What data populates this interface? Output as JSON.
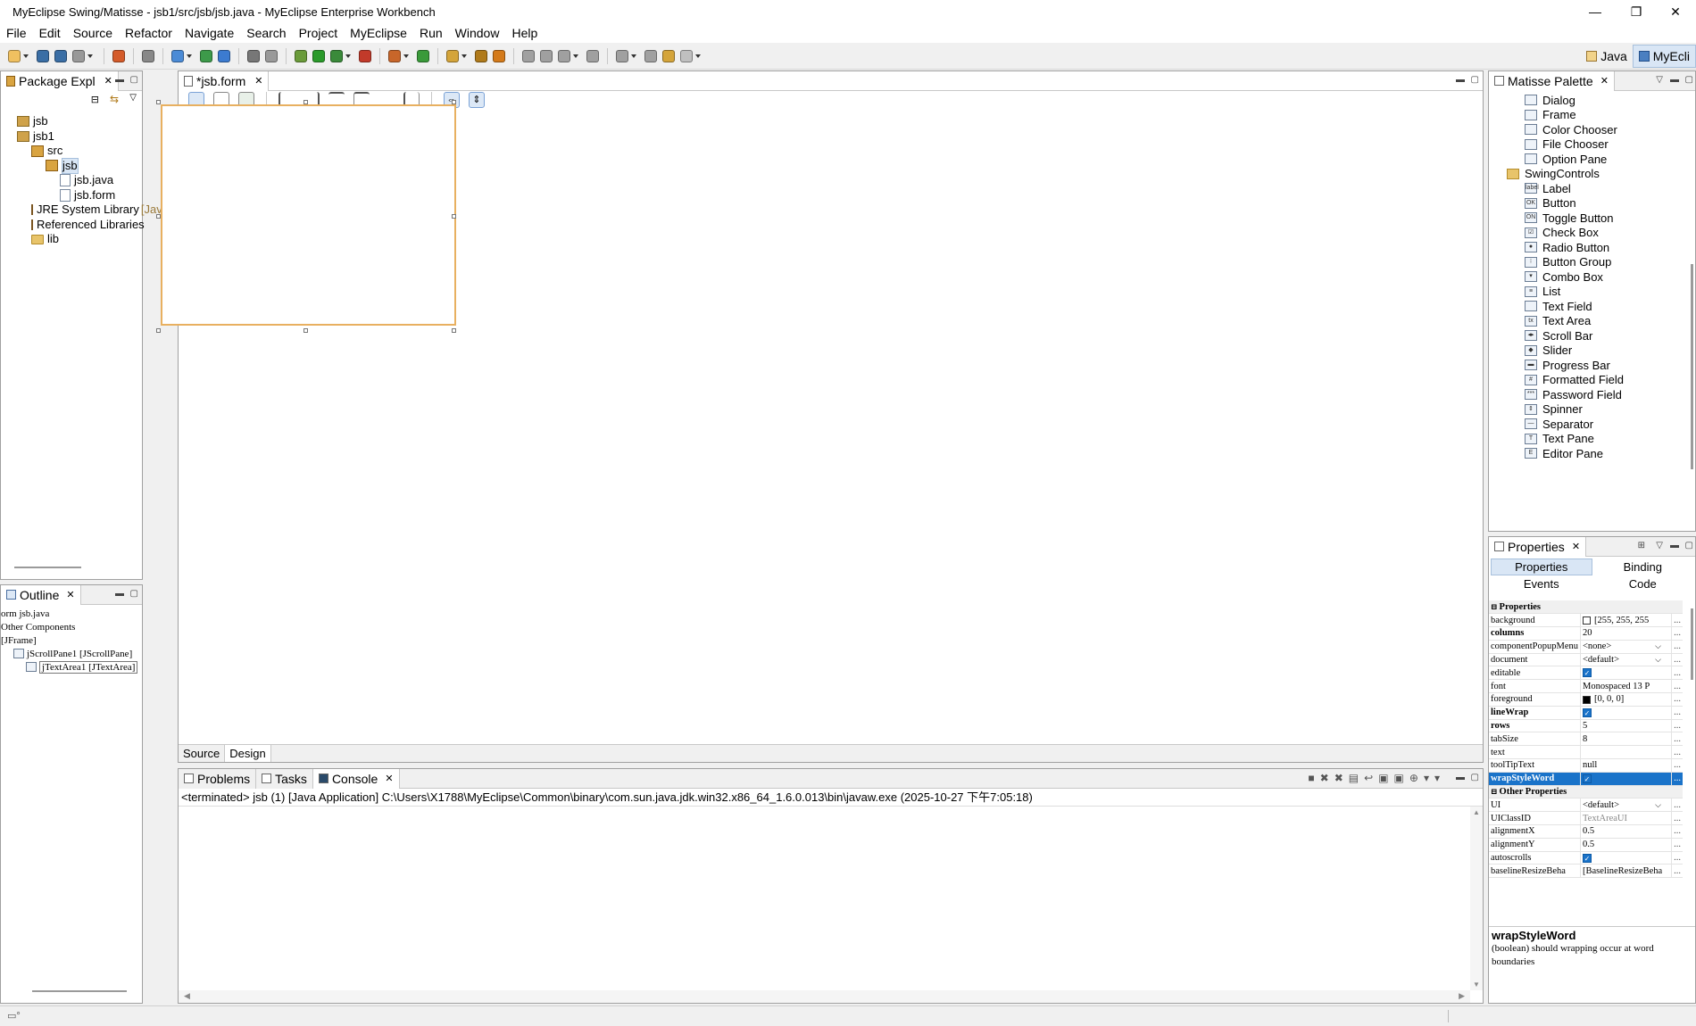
{
  "window": {
    "title": "MyEclipse Swing/Matisse - jsb1/src/jsb/jsb.java - MyEclipse Enterprise Workbench",
    "minimize": "—",
    "maximize": "❐",
    "close": "✕"
  },
  "menu": [
    "File",
    "Edit",
    "Source",
    "Refactor",
    "Navigate",
    "Search",
    "Project",
    "MyEclipse",
    "Run",
    "Window",
    "Help"
  ],
  "perspectives": {
    "java": "Java",
    "myeclipse": "MyEcli"
  },
  "package_explorer": {
    "title": "Package Expl",
    "items": [
      {
        "label": "jsb",
        "icon": "project-icon",
        "depth": 0
      },
      {
        "label": "jsb1",
        "icon": "project-icon",
        "depth": 0
      },
      {
        "label": "src",
        "icon": "source-folder-icon",
        "depth": 1
      },
      {
        "label": "jsb",
        "icon": "package-icon",
        "depth": 2,
        "selected": true
      },
      {
        "label": "jsb.java",
        "icon": "java-file-icon",
        "depth": 3
      },
      {
        "label": "jsb.form",
        "icon": "form-file-icon",
        "depth": 3
      },
      {
        "label": "JRE System Library",
        "suffix": "[Jav",
        "icon": "library-icon",
        "depth": 1
      },
      {
        "label": "Referenced Libraries",
        "icon": "library-icon",
        "depth": 1
      },
      {
        "label": "lib",
        "icon": "folder-icon",
        "depth": 1
      }
    ]
  },
  "outline": {
    "title": "Outline",
    "items": [
      {
        "label": "orm jsb.java",
        "depth": 0
      },
      {
        "label": "Other Components",
        "depth": 0
      },
      {
        "label": "[JFrame]",
        "depth": 0
      },
      {
        "label": "jScrollPane1 [JScrollPane]",
        "depth": 1
      },
      {
        "label": "jTextArea1 [JTextArea]",
        "depth": 2,
        "selected": true
      }
    ]
  },
  "editor": {
    "tab": "*jsb.form",
    "bottom_tabs": [
      "Source",
      "Design"
    ]
  },
  "console": {
    "tabs": [
      "Problems",
      "Tasks",
      "Console"
    ],
    "status": "<terminated> jsb (1) [Java Application] C:\\Users\\X1788\\MyEclipse\\Common\\binary\\com.sun.java.jdk.win32.x86_64_1.6.0.013\\bin\\javaw.exe (2025-10-27 下午7:05:18)"
  },
  "palette": {
    "title": "Matisse Palette",
    "items": [
      {
        "label": "Dialog",
        "icon": "dialog-icon",
        "group": false
      },
      {
        "label": "Frame",
        "icon": "frame-icon",
        "group": false
      },
      {
        "label": "Color Chooser",
        "icon": "color-chooser-icon",
        "group": false
      },
      {
        "label": "File Chooser",
        "icon": "file-chooser-icon",
        "group": false
      },
      {
        "label": "Option Pane",
        "icon": "option-pane-icon",
        "group": false
      },
      {
        "label": "SwingControls",
        "icon": "folder-icon",
        "group": true
      },
      {
        "label": "Label",
        "icon": "label-icon",
        "glyph": "label",
        "group": false
      },
      {
        "label": "Button",
        "icon": "button-icon",
        "glyph": "OK",
        "group": false
      },
      {
        "label": "Toggle Button",
        "icon": "toggle-button-icon",
        "glyph": "ON",
        "group": false
      },
      {
        "label": "Check Box",
        "icon": "check-box-icon",
        "glyph": "☑",
        "group": false
      },
      {
        "label": "Radio Button",
        "icon": "radio-button-icon",
        "glyph": "●",
        "group": false
      },
      {
        "label": "Button Group",
        "icon": "button-group-icon",
        "glyph": "⁝",
        "group": false
      },
      {
        "label": "Combo Box",
        "icon": "combo-box-icon",
        "glyph": "▾",
        "group": false
      },
      {
        "label": "List",
        "icon": "list-icon",
        "glyph": "≡",
        "group": false
      },
      {
        "label": "Text Field",
        "icon": "text-field-icon",
        "glyph": "",
        "group": false
      },
      {
        "label": "Text Area",
        "icon": "text-area-icon",
        "glyph": "tx",
        "group": false
      },
      {
        "label": "Scroll Bar",
        "icon": "scroll-bar-icon",
        "glyph": "◂▸",
        "group": false
      },
      {
        "label": "Slider",
        "icon": "slider-icon",
        "glyph": "◆",
        "group": false
      },
      {
        "label": "Progress Bar",
        "icon": "progress-bar-icon",
        "glyph": "▬",
        "group": false
      },
      {
        "label": "Formatted Field",
        "icon": "formatted-field-icon",
        "glyph": "#",
        "group": false
      },
      {
        "label": "Password Field",
        "icon": "password-field-icon",
        "glyph": "***",
        "group": false
      },
      {
        "label": "Spinner",
        "icon": "spinner-icon",
        "glyph": "⇕",
        "group": false
      },
      {
        "label": "Separator",
        "icon": "separator-icon",
        "glyph": "—",
        "group": false
      },
      {
        "label": "Text Pane",
        "icon": "text-pane-icon",
        "glyph": "T",
        "group": false
      },
      {
        "label": "Editor Pane",
        "icon": "editor-pane-icon",
        "glyph": "E",
        "group": false
      }
    ]
  },
  "properties": {
    "title": "Properties",
    "tabs": {
      "properties": "Properties",
      "binding": "Binding",
      "events": "Events",
      "code": "Code"
    },
    "sections": [
      {
        "name": "Properties",
        "rows": [
          {
            "name": "background",
            "value": "[255, 255, 255",
            "bold": false,
            "kind": "color",
            "color": "#ffffff"
          },
          {
            "name": "columns",
            "value": "20",
            "bold": true,
            "kind": "text"
          },
          {
            "name": "componentPopupMenu",
            "value": "<none>",
            "bold": false,
            "kind": "combo"
          },
          {
            "name": "document",
            "value": "<default>",
            "bold": false,
            "kind": "combo"
          },
          {
            "name": "editable",
            "value": "",
            "bold": false,
            "kind": "check"
          },
          {
            "name": "font",
            "value": "Monospaced 13 P",
            "bold": false,
            "kind": "text"
          },
          {
            "name": "foreground",
            "value": "[0, 0, 0]",
            "bold": false,
            "kind": "color",
            "color": "#000000"
          },
          {
            "name": "lineWrap",
            "value": "",
            "bold": true,
            "kind": "check"
          },
          {
            "name": "rows",
            "value": "5",
            "bold": true,
            "kind": "text"
          },
          {
            "name": "tabSize",
            "value": "8",
            "bold": false,
            "kind": "text"
          },
          {
            "name": "text",
            "value": "",
            "bold": false,
            "kind": "text"
          },
          {
            "name": "toolTipText",
            "value": "null",
            "bold": false,
            "kind": "text"
          },
          {
            "name": "wrapStyleWord",
            "value": "",
            "bold": true,
            "kind": "check",
            "selected": true
          }
        ]
      },
      {
        "name": "Other Properties",
        "rows": [
          {
            "name": "UI",
            "value": "<default>",
            "bold": false,
            "kind": "combo"
          },
          {
            "name": "UIClassID",
            "value": "TextAreaUI",
            "bold": false,
            "kind": "text",
            "dim": true
          },
          {
            "name": "alignmentX",
            "value": "0.5",
            "bold": false,
            "kind": "text"
          },
          {
            "name": "alignmentY",
            "value": "0.5",
            "bold": false,
            "kind": "text"
          },
          {
            "name": "autoscrolls",
            "value": "",
            "bold": false,
            "kind": "check"
          },
          {
            "name": "baselineResizeBeha",
            "value": "[BaselineResizeBeha",
            "bold": false,
            "kind": "text"
          }
        ]
      }
    ],
    "help": {
      "title": "wrapStyleWord",
      "text": "(boolean)  should wrapping occur at word boundaries"
    }
  },
  "colors": {
    "selection": "#1a73c9",
    "frame_border": "#e8b060",
    "accent_tab": "#d9e6f5"
  }
}
